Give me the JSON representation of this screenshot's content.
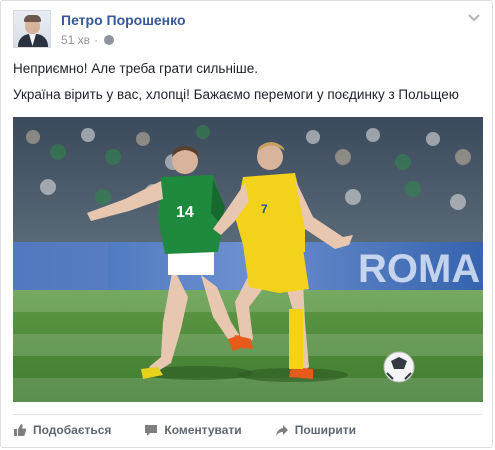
{
  "post": {
    "author": "Петро Порошенко",
    "time": "51 хв",
    "separator": "·",
    "text_line1": "Неприємно! Але треба грати сильніше.",
    "text_line2": "Україна вірить у вас, хлопці! Бажаємо перемоги у поєдинку з Польщею",
    "photo": {
      "board_text": "ROMAN",
      "player_left_number": "14",
      "player_right_number": "7"
    }
  },
  "actions": {
    "like": "Подобається",
    "comment": "Коментувати",
    "share": "Поширити"
  },
  "colors": {
    "author_link": "#365899",
    "meta_gray": "#90949c",
    "action_gray": "#616770",
    "pitch_green": "#4f8a3b",
    "ukraine_yellow": "#f2d21a",
    "green_kit": "#1f8a3e"
  },
  "icons": {
    "privacy": "globe-icon",
    "options": "chevron-down-icon",
    "like": "thumbs-up-icon",
    "comment": "speech-bubble-icon",
    "share": "share-arrow-icon"
  }
}
